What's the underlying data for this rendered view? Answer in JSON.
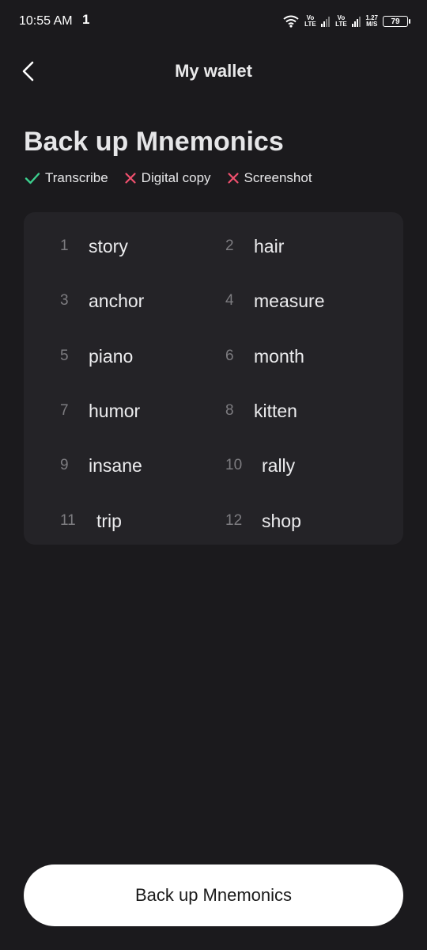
{
  "status_bar": {
    "time": "10:55 AM",
    "upload_indicator": "1",
    "sim1_label": "Vo LTE",
    "sim2_label": "Vo LTE",
    "net_speed": "1.27",
    "net_speed_unit": "M/S",
    "battery": "79"
  },
  "header": {
    "title": "My wallet"
  },
  "page": {
    "title": "Back up Mnemonics",
    "rules": [
      {
        "label": "Transcribe",
        "allowed": true
      },
      {
        "label": "Digital copy",
        "allowed": false
      },
      {
        "label": "Screenshot",
        "allowed": false
      }
    ]
  },
  "mnemonics": [
    {
      "index": "1",
      "word": "story"
    },
    {
      "index": "2",
      "word": "hair"
    },
    {
      "index": "3",
      "word": "anchor"
    },
    {
      "index": "4",
      "word": "measure"
    },
    {
      "index": "5",
      "word": "piano"
    },
    {
      "index": "6",
      "word": "month"
    },
    {
      "index": "7",
      "word": "humor"
    },
    {
      "index": "8",
      "word": "kitten"
    },
    {
      "index": "9",
      "word": "insane"
    },
    {
      "index": "10",
      "word": "rally"
    },
    {
      "index": "11",
      "word": "trip"
    },
    {
      "index": "12",
      "word": "shop"
    }
  ],
  "footer": {
    "button_label": "Back up Mnemonics"
  },
  "colors": {
    "background": "#1b1a1d",
    "card": "#242327",
    "allowed": "#3ccf8e",
    "forbidden": "#f0506e"
  }
}
